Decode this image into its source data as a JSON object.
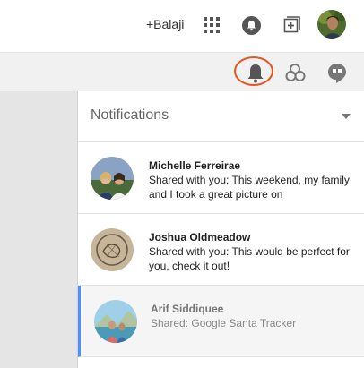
{
  "topbar": {
    "user_link": "+Balaji",
    "apps_icon": "apps-grid-icon",
    "notifications_icon": "notifications-bell-icon",
    "share_icon": "share-plus-icon",
    "avatar": "account-avatar"
  },
  "subbar": {
    "icons": [
      "notifications-bell-icon",
      "circles-icon",
      "hangouts-icon"
    ],
    "highlight_color": "#e8541e"
  },
  "notifications": {
    "title": "Notifications",
    "items": [
      {
        "name": "Michelle Ferreirae",
        "text": "Shared with you: This weekend, my family and I took a great picture on",
        "read": false
      },
      {
        "name": "Joshua Oldmeadow",
        "text": "Shared with you: This would be perfect for you, check it out!",
        "read": false
      },
      {
        "name": "Arif Siddiquee",
        "text": "Shared: Google Santa Tracker",
        "read": true
      }
    ]
  },
  "colors": {
    "accent_blue": "#4d90fe",
    "highlight": "#e8541e",
    "subbar_bg": "#f1f1f1"
  }
}
